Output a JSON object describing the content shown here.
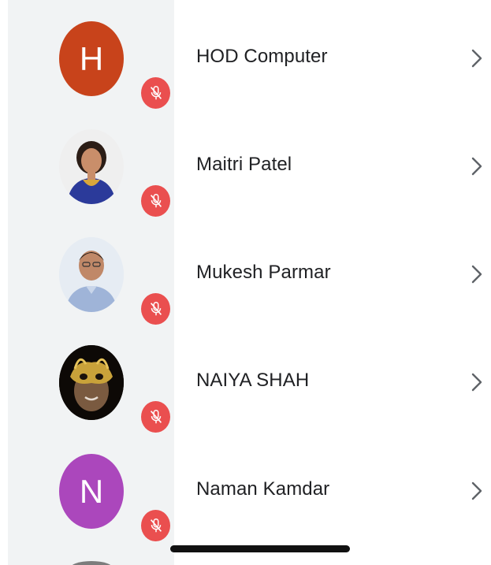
{
  "participants": [
    {
      "name": "HOD Computer",
      "avatar": {
        "type": "letter",
        "letter": "H",
        "color": "#c8431b"
      },
      "muted": true
    },
    {
      "name": "Maitri Patel",
      "avatar": {
        "type": "photo",
        "icon": "photo-avatar-woman"
      },
      "muted": true
    },
    {
      "name": "Mukesh Parmar",
      "avatar": {
        "type": "photo",
        "icon": "photo-avatar-man"
      },
      "muted": true
    },
    {
      "name": "NAIYA SHAH",
      "avatar": {
        "type": "photo",
        "icon": "photo-avatar-masked"
      },
      "muted": true
    },
    {
      "name": "Naman Kamdar",
      "avatar": {
        "type": "letter",
        "letter": "N",
        "color": "#ab47bc"
      },
      "muted": true
    }
  ],
  "icons": {
    "mute": "mic-off-icon",
    "chevron": "chevron-right-icon"
  },
  "colors": {
    "mute_badge": "#ea4f4f",
    "avatar_column_bg": "#f1f3f4",
    "name_text": "#202124",
    "chevron": "#5f6368"
  }
}
